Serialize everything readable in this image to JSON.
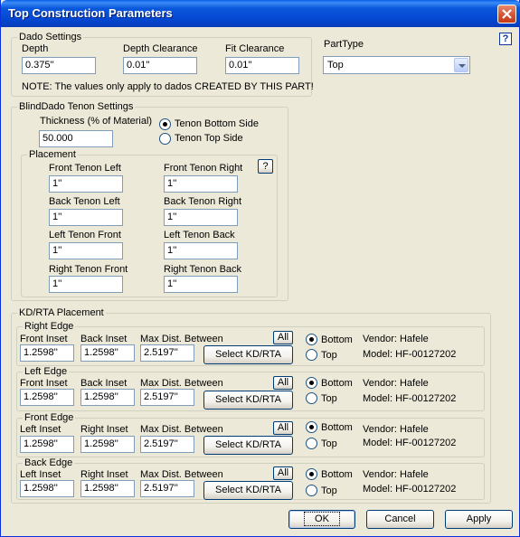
{
  "window": {
    "title": "Top Construction Parameters"
  },
  "dado": {
    "group_title": "Dado Settings",
    "depth_label": "Depth",
    "depth_value": "0.375''",
    "depth_clearance_label": "Depth Clearance",
    "depth_clearance_value": "0.01''",
    "fit_clearance_label": "Fit Clearance",
    "fit_clearance_value": "0.01''",
    "note": "NOTE: The values only apply to dados CREATED BY THIS PART!"
  },
  "part_type": {
    "label": "PartType",
    "selected": "Top"
  },
  "help": {
    "q": "?"
  },
  "tenon": {
    "group_title": "BlindDado Tenon Settings",
    "thickness_label": "Thickness (% of Material)",
    "thickness_value": "50.000",
    "bottom_side_label": "Tenon Bottom Side",
    "top_side_label": "Tenon Top Side",
    "selected": "Tenon Bottom Side",
    "placement": {
      "group_title": "Placement",
      "help": "?",
      "front_left_label": "Front Tenon Left",
      "front_left_value": "1''",
      "front_right_label": "Front Tenon Right",
      "front_right_value": "1''",
      "back_left_label": "Back Tenon Left",
      "back_left_value": "1''",
      "back_right_label": "Back Tenon Right",
      "back_right_value": "1''",
      "left_front_label": "Left Tenon Front",
      "left_front_value": "1''",
      "left_back_label": "Left Tenon Back",
      "left_back_value": "1''",
      "right_front_label": "Right Tenon Front",
      "right_front_value": "1''",
      "right_back_label": "Right Tenon Back",
      "right_back_value": "1''"
    }
  },
  "kd": {
    "group_title": "KD/RTA Placement",
    "all_label": "All",
    "select_label": "Select KD/RTA",
    "bottom_label": "Bottom",
    "top_label": "Top",
    "max_label": "Max Dist. Between",
    "edges": [
      {
        "title": "Right Edge",
        "inset1_label": "Front Inset",
        "inset1_value": "1.2598''",
        "inset2_label": "Back Inset",
        "inset2_value": "1.2598''",
        "max_value": "2.5197''",
        "selected": "Bottom",
        "vendor": "Vendor: Hafele",
        "model": "Model: HF-00127202"
      },
      {
        "title": "Left Edge",
        "inset1_label": "Front Inset",
        "inset1_value": "1.2598''",
        "inset2_label": "Back Inset",
        "inset2_value": "1.2598''",
        "max_value": "2.5197''",
        "selected": "Bottom",
        "vendor": "Vendor: Hafele",
        "model": "Model: HF-00127202"
      },
      {
        "title": "Front Edge",
        "inset1_label": "Left Inset",
        "inset1_value": "1.2598''",
        "inset2_label": "Right Inset",
        "inset2_value": "1.2598''",
        "max_value": "2.5197''",
        "selected": "Bottom",
        "vendor": "Vendor: Hafele",
        "model": "Model: HF-00127202"
      },
      {
        "title": "Back Edge",
        "inset1_label": "Left Inset",
        "inset1_value": "1.2598''",
        "inset2_label": "Right Inset",
        "inset2_value": "1.2598''",
        "max_value": "2.5197''",
        "selected": "Bottom",
        "vendor": "Vendor: Hafele",
        "model": "Model: HF-00127202"
      }
    ]
  },
  "buttons": {
    "ok": "OK",
    "cancel": "Cancel",
    "apply": "Apply"
  },
  "colors": {
    "title_bar": "#0548D2",
    "window_bg": "#ECE9D8",
    "close": "#D3502E"
  }
}
